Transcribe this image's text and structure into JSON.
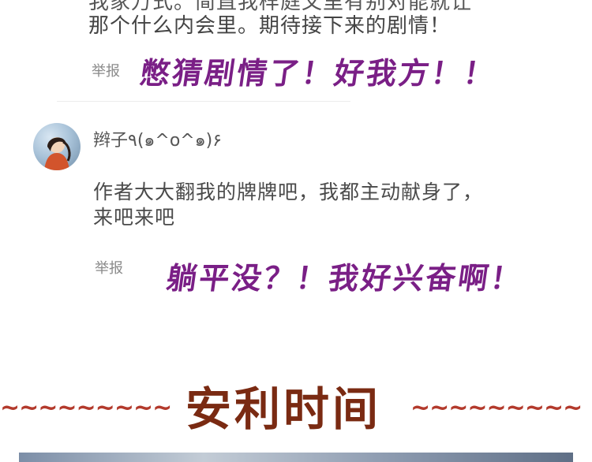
{
  "comment1": {
    "text_line2": "那个什么内会里。期待接下来的剧情！",
    "report_label": "举报",
    "annotation": "憋猜剧情了！好我方！！"
  },
  "comment2": {
    "username": "辫子٩(๑^o^๑)۶",
    "text": "作者大大翻我的牌牌吧，我都主动献身了，来吧来吧",
    "report_label": "举报",
    "annotation": "躺平没？！我好兴奋啊！"
  },
  "section": {
    "title": "安利时间",
    "wave_left": "~~~~~~~~~",
    "wave_right": "~~~~~~~~~"
  }
}
